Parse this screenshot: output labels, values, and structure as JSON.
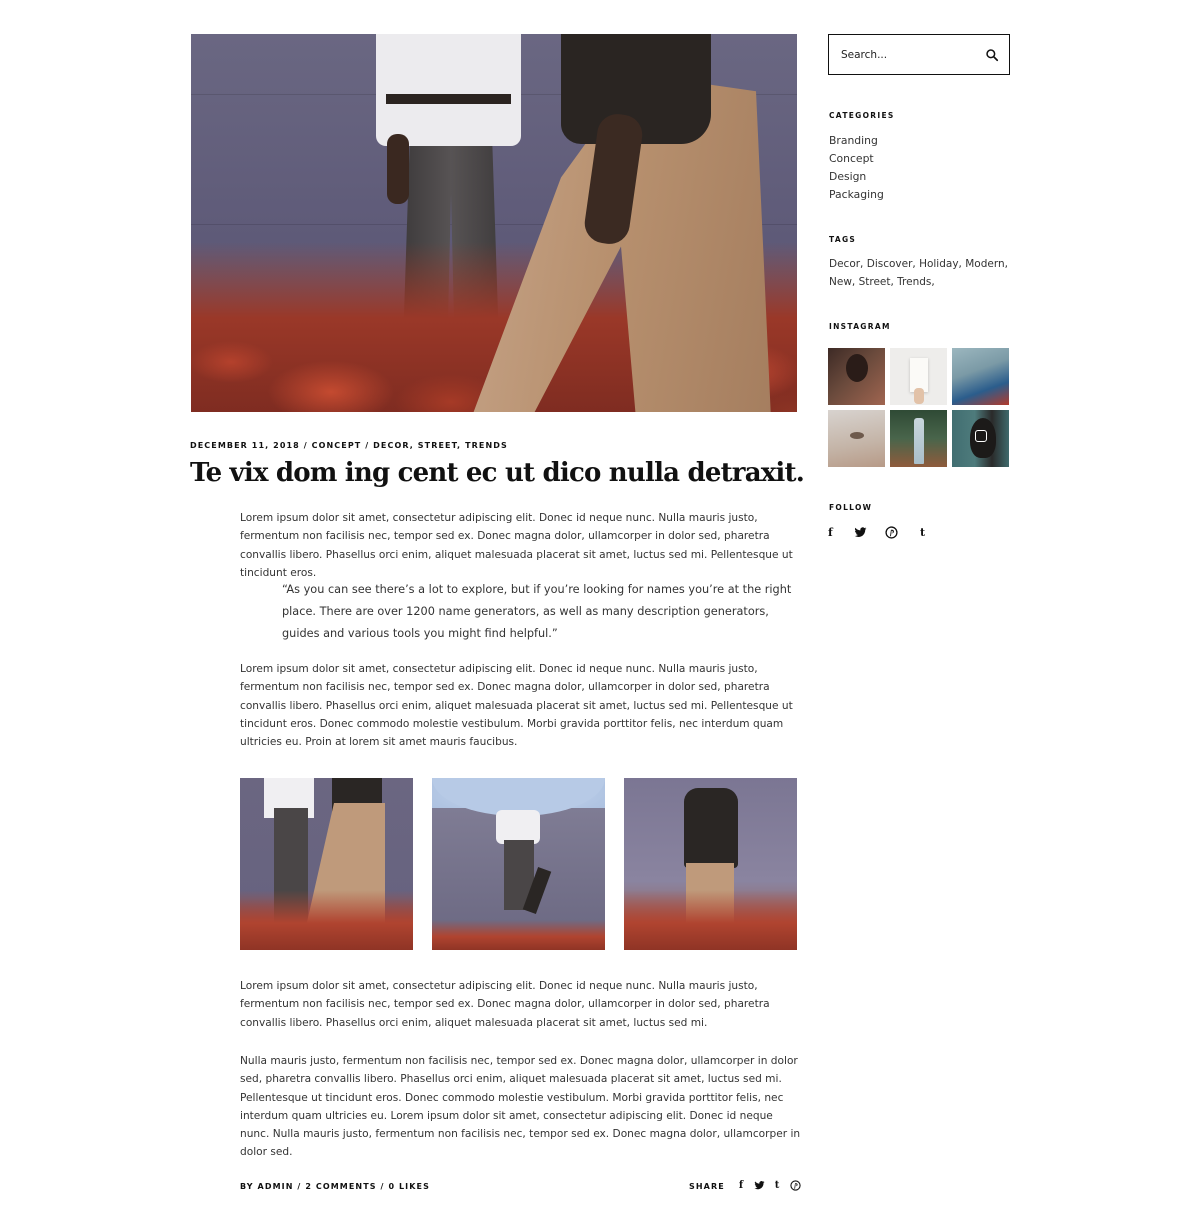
{
  "post": {
    "meta": {
      "date": "DECEMBER 11, 2018",
      "separator": " / ",
      "category": "CONCEPT",
      "tags": [
        "DECOR",
        "STREET",
        "TRENDS"
      ]
    },
    "title": "Te vix dom ing cent ec ut dico nulla detraxit.",
    "paragraphs": {
      "p1": "Lorem ipsum dolor sit amet, consectetur adipiscing elit. Donec id neque nunc. Nulla mauris justo, fermentum non facilisis nec, tempor sed ex. Donec magna dolor, ullamcorper in dolor sed, pharetra convallis libero. Phasellus orci enim, aliquet malesuada placerat sit amet, luctus sed mi. Pellentesque ut tincidunt eros.",
      "quote": "“As you can see there’s a lot to explore, but if you’re looking for names you’re at the right place. There are over 1200 name generators, as well as many description generators, guides and various tools you might find helpful.”",
      "p2": "Lorem ipsum dolor sit amet, consectetur adipiscing elit. Donec id neque nunc. Nulla mauris justo, fermentum non facilisis nec, tempor sed ex. Donec magna dolor, ullamcorper in dolor sed, pharetra convallis libero. Phasellus orci enim, aliquet malesuada placerat sit amet, luctus sed mi. Pellentesque ut tincidunt eros. Donec commodo molestie vestibulum. Morbi gravida porttitor felis, nec interdum quam ultricies eu. Proin at lorem sit amet mauris faucibus.",
      "p3": "Lorem ipsum dolor sit amet, consectetur adipiscing elit. Donec id neque nunc. Nulla mauris justo, fermentum non facilisis nec, tempor sed ex. Donec magna dolor, ullamcorper in dolor sed, pharetra convallis libero. Phasellus orci enim, aliquet malesuada placerat sit amet, luctus sed mi.",
      "p4": "Nulla mauris justo, fermentum non facilisis nec, tempor sed ex. Donec magna dolor, ullamcorper in dolor sed, pharetra convallis libero. Phasellus orci enim, aliquet malesuada placerat sit amet, luctus sed mi. Pellentesque ut tincidunt eros. Donec commodo molestie vestibulum. Morbi gravida porttitor felis, nec interdum quam ultricies eu. Lorem ipsum dolor sit amet, consectetur adipiscing elit. Donec id neque nunc. Nulla mauris justo, fermentum non facilisis nec, tempor sed ex. Donec magna dolor, ullamcorper in dolor sed."
    },
    "footer": {
      "author": "BY ADMIN",
      "comments": "2 COMMENTS",
      "likes": "0 LIKES",
      "separator": " / ",
      "share_label": "SHARE",
      "share_icons": [
        "facebook-icon",
        "twitter-icon",
        "tumblr-icon",
        "pinterest-icon"
      ]
    }
  },
  "sidebar": {
    "search": {
      "placeholder": "Search...",
      "icon": "search-icon"
    },
    "categories": {
      "title": "CATEGORIES",
      "items": [
        "Branding",
        "Concept",
        "Design",
        "Packaging"
      ]
    },
    "tags": {
      "title": "TAGS",
      "text": "Decor, Discover, Holiday, Modern, New, Street, Trends,"
    },
    "instagram": {
      "title": "INSTAGRAM"
    },
    "follow": {
      "title": "FOLLOW",
      "icons": [
        "facebook-icon",
        "twitter-icon",
        "pinterest-icon",
        "tumblr-icon"
      ]
    }
  },
  "colors": {
    "text": "#111111",
    "body_text": "#333333",
    "background": "#ffffff"
  }
}
